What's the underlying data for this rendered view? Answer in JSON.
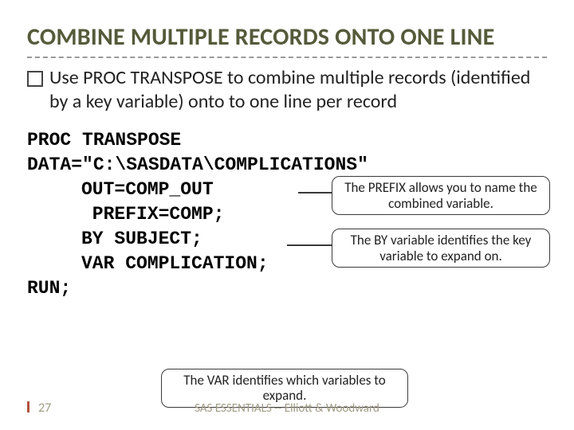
{
  "title": "COMBINE MULTIPLE RECORDS ONTO ONE LINE",
  "bullet": "Use PROC TRANSPOSE  to combine multiple records (identified by a key variable) onto to one line per record",
  "code": {
    "l1": "PROC TRANSPOSE",
    "l2": "DATA=\"C:\\SASDATA\\COMPLICATIONS\"",
    "l3": "OUT=COMP_OUT",
    "l4": " PREFIX=COMP;",
    "l5": "BY SUBJECT;",
    "l6": "VAR COMPLICATION;",
    "l7": "RUN;"
  },
  "callouts": {
    "prefix": "The PREFIX allows you to name the combined variable.",
    "by": "The BY variable identifies the key variable to expand on.",
    "var": "The VAR identifies which variables to expand."
  },
  "footer": {
    "page": "27",
    "text": "SAS ESSENTIALS -- Elliott & Woodward"
  }
}
